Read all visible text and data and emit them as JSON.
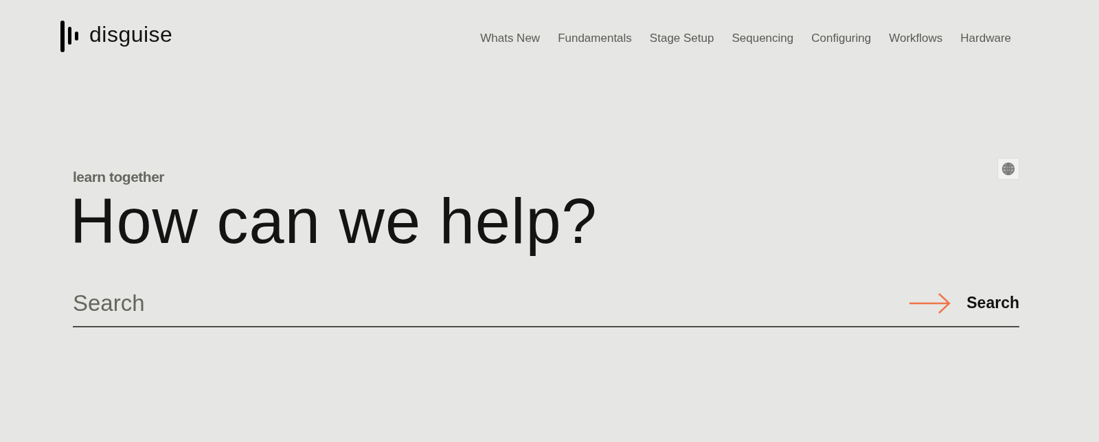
{
  "logo": {
    "text": "disguise"
  },
  "nav": [
    {
      "label": "Whats New"
    },
    {
      "label": "Fundamentals"
    },
    {
      "label": "Stage Setup"
    },
    {
      "label": "Sequencing"
    },
    {
      "label": "Configuring"
    },
    {
      "label": "Workflows"
    },
    {
      "label": "Hardware"
    }
  ],
  "hero": {
    "eyebrow": "learn together",
    "heading": "How can we help?"
  },
  "search": {
    "placeholder": "Search",
    "button": "Search"
  }
}
